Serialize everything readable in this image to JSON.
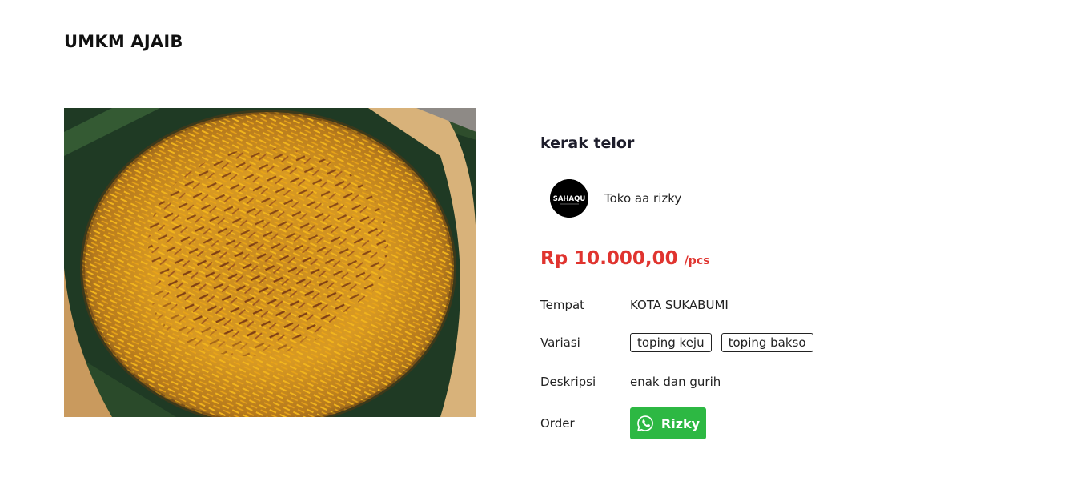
{
  "header": {
    "brand": "UMKM AJAIB"
  },
  "product": {
    "title": "kerak telor",
    "price": "Rp 10.000,00",
    "unit": "/pcs",
    "image_icon": "kerak-telor-photo"
  },
  "seller": {
    "name": "Toko aa rizky",
    "avatar_text": "SAHAQU"
  },
  "details": {
    "tempat_label": "Tempat",
    "tempat_value": "KOTA SUKABUMI",
    "variasi_label": "Variasi",
    "variasi_tags": [
      "toping keju",
      "toping bakso"
    ],
    "deskripsi_label": "Deskripsi",
    "deskripsi_value": "enak dan gurih",
    "order_label": "Order",
    "order_button_label": "Rizky",
    "order_button_icon": "whatsapp-icon"
  },
  "colors": {
    "price": "#e0342f",
    "whatsapp": "#2db843"
  }
}
